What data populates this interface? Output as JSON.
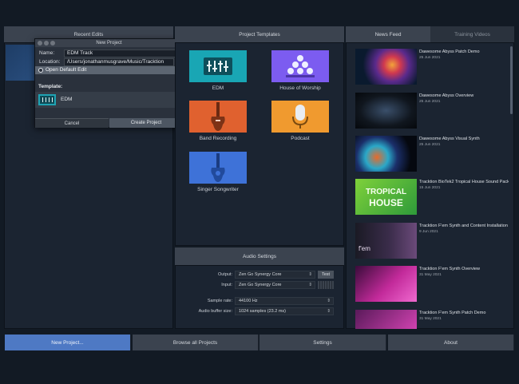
{
  "recent_edits": {
    "header": "Recent Edits"
  },
  "dialog": {
    "title": "New Project",
    "name_label": "Name:",
    "name_value": "EDM Track",
    "location_label": "Location:",
    "location_value": "/Users/jonathanmusgrave/Music/Tracktion",
    "browse_label": "...",
    "open_default_label": "Open Default Edit",
    "template_title": "Template:",
    "template_name": "EDM",
    "template_arrow": "▶",
    "cancel_label": "Cancel",
    "create_label": "Create Project"
  },
  "templates": {
    "header": "Project Templates",
    "items": [
      {
        "label": "EDM",
        "icon": "mixer-icon",
        "color": "#19a6b4"
      },
      {
        "label": "House of Worship",
        "icon": "choir-icon",
        "color": "#7c5cf0"
      },
      {
        "label": "Band Recording",
        "icon": "electric-guitar-icon",
        "color": "#e0612f"
      },
      {
        "label": "Podcast",
        "icon": "microphone-icon",
        "color": "#f09a2f"
      },
      {
        "label": "Singer Songwriter",
        "icon": "acoustic-guitar-icon",
        "color": "#3e72d8"
      }
    ]
  },
  "audio": {
    "header": "Audio Settings",
    "output_label": "Output:",
    "output_value": "Zen Go Synergy Core",
    "test_label": "Test",
    "input_label": "Input:",
    "input_value": "Zen Go Synergy Core",
    "sample_rate_label": "Sample rate:",
    "sample_rate_value": "44100 Hz",
    "buffer_label": "Audio buffer size:",
    "buffer_value": "1024 samples (23.2 ms)",
    "chevron": "⇕"
  },
  "news": {
    "tab_news": "News Feed",
    "tab_training": "Training Videos",
    "items": [
      {
        "title": "Dawesome Abyss Patch Demo",
        "date": "25 Jun 2021"
      },
      {
        "title": "Dawesome Abyss Overview",
        "date": "25 Jun 2021"
      },
      {
        "title": "Dawesome Abyss Visual Synth",
        "date": "25 Jun 2021"
      },
      {
        "title": "Tracktion BioTek2 Tropical House Sound Pack",
        "date": "15 Jun 2021",
        "thumb_text_1": "TROPICAL",
        "thumb_text_2": "HOUSE"
      },
      {
        "title": "Tracktion F'em Synth and Content Installation",
        "date": "9 Jun 2021",
        "thumb_text_1": "f'em"
      },
      {
        "title": "Tracktion F'em Synth Overview",
        "date": "31 May 2021"
      },
      {
        "title": "Tracktion F'em Synth Patch Demo",
        "date": "31 May 2021"
      }
    ]
  },
  "bottom": {
    "new_project": "New Project...",
    "browse_all": "Browse all Projects",
    "settings": "Settings",
    "about": "About"
  }
}
